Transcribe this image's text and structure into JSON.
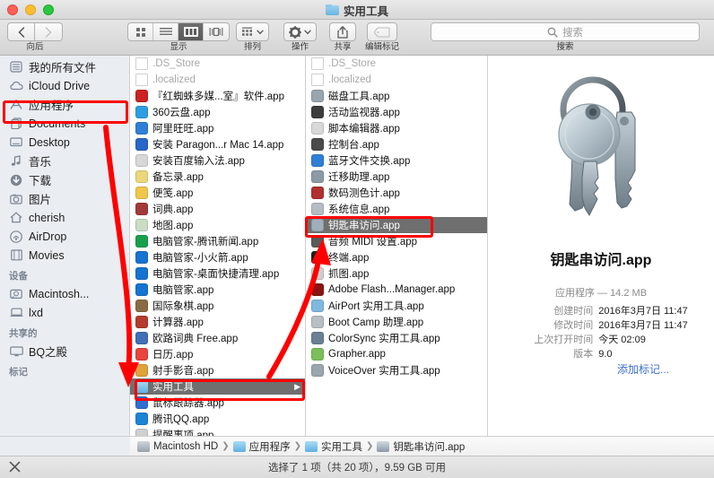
{
  "window": {
    "title": "实用工具",
    "traffic_lights": [
      "close",
      "minimize",
      "zoom"
    ]
  },
  "toolbar": {
    "back_label": "向后",
    "back_icon": "chevron-left",
    "forward_icon": "chevron-right",
    "view_label": "显示",
    "view_modes": [
      "icon-view",
      "list-view",
      "column-view",
      "coverflow-view"
    ],
    "view_active": "column-view",
    "arrange_label": "排列",
    "arrange_icon": "grid-sort",
    "action_label": "操作",
    "action_icon": "gear",
    "share_label": "共享",
    "share_icon": "share-arrow",
    "tag_label": "编辑标记",
    "tag_icon": "tag",
    "search_label": "搜索",
    "search_placeholder": "搜索"
  },
  "sidebar": {
    "favorites": [
      {
        "label": "我的所有文件",
        "icon": "all-files-icon"
      },
      {
        "label": "iCloud Drive",
        "icon": "cloud-icon"
      },
      {
        "label": "应用程序",
        "icon": "applications-icon"
      },
      {
        "label": "Documents",
        "icon": "documents-icon"
      },
      {
        "label": "Desktop",
        "icon": "desktop-icon"
      },
      {
        "label": "音乐",
        "icon": "music-icon"
      },
      {
        "label": "下载",
        "icon": "downloads-icon"
      },
      {
        "label": "图片",
        "icon": "pictures-icon"
      },
      {
        "label": "cherish",
        "icon": "home-icon"
      },
      {
        "label": "AirDrop",
        "icon": "airdrop-icon"
      },
      {
        "label": "Movies",
        "icon": "movies-icon"
      }
    ],
    "devices_header": "设备",
    "devices": [
      {
        "label": "Macintosh...",
        "icon": "harddisk-icon"
      },
      {
        "label": "lxd",
        "icon": "laptop-icon"
      }
    ],
    "shared_header": "共享的",
    "shared": [
      {
        "label": "BQ之殿",
        "icon": "display-icon"
      }
    ],
    "tags_header": "标记"
  },
  "columns": [
    {
      "name": "applications-column",
      "items": [
        {
          "label": ".DS_Store",
          "icon": "blank-doc",
          "dim": true
        },
        {
          "label": ".localized",
          "icon": "blank-doc",
          "dim": true
        },
        {
          "label": "『红蜘蛛多媒...室』软件.app",
          "icon": "red-spider",
          "color": "#cc2222"
        },
        {
          "label": "360云盘.app",
          "icon": "cloud360",
          "color": "#2e9ee0"
        },
        {
          "label": "阿里旺旺.app",
          "icon": "aliww",
          "color": "#2f7fd6"
        },
        {
          "label": "安装 Paragon...r Mac 14.app",
          "icon": "paragon",
          "color": "#2767c8"
        },
        {
          "label": "安装百度输入法.app",
          "icon": "baidu-ime",
          "color": "#d7d7d7"
        },
        {
          "label": "备忘录.app",
          "icon": "notes",
          "color": "#e9d77a"
        },
        {
          "label": "便笺.app",
          "icon": "stickies",
          "color": "#f0c64b"
        },
        {
          "label": "词典.app",
          "icon": "dictionary",
          "color": "#a33a3a"
        },
        {
          "label": "地图.app",
          "icon": "maps",
          "color": "#c9dcc4"
        },
        {
          "label": "电脑管家-腾讯新闻.app",
          "icon": "qqmgr-news",
          "color": "#19a04d"
        },
        {
          "label": "电脑管家-小火箭.app",
          "icon": "qqmgr-rocket",
          "color": "#1673d2"
        },
        {
          "label": "电脑管家-桌面快捷清理.app",
          "icon": "qqmgr-clean",
          "color": "#1673d2"
        },
        {
          "label": "电脑管家.app",
          "icon": "qqmgr",
          "color": "#1673d2"
        },
        {
          "label": "国际象棋.app",
          "icon": "chess",
          "color": "#8b6b44"
        },
        {
          "label": "计算器.app",
          "icon": "calculator",
          "color": "#b43b2e"
        },
        {
          "label": "欧路词典 Free.app",
          "icon": "eudic",
          "color": "#3f6fb5"
        },
        {
          "label": "日历.app",
          "icon": "calendar",
          "color": "#e8433c"
        },
        {
          "label": "射手影音.app",
          "icon": "splayer",
          "color": "#e0a23a"
        },
        {
          "label": "实用工具",
          "icon": "utilities-folder",
          "color": "#6fb9e6",
          "selected": true,
          "has_children": true
        },
        {
          "label": "鼠标跟踪器.app",
          "icon": "mouse-tracker",
          "color": "#2f6fd0"
        },
        {
          "label": "腾讯QQ.app",
          "icon": "qq",
          "color": "#1c84d6"
        },
        {
          "label": "提醒事项.app",
          "icon": "reminders",
          "color": "#cfcfcf",
          "clipped": true
        }
      ]
    },
    {
      "name": "utilities-column",
      "items": [
        {
          "label": ".DS_Store",
          "icon": "blank-doc",
          "dim": true
        },
        {
          "label": ".localized",
          "icon": "blank-doc",
          "dim": true
        },
        {
          "label": "磁盘工具.app",
          "icon": "disk-utility",
          "color": "#9aa6ae"
        },
        {
          "label": "活动监视器.app",
          "icon": "activity-monitor",
          "color": "#3d3d3d"
        },
        {
          "label": "脚本编辑器.app",
          "icon": "script-editor",
          "color": "#d8d8d8"
        },
        {
          "label": "控制台.app",
          "icon": "console",
          "color": "#4a4a4a"
        },
        {
          "label": "蓝牙文件交换.app",
          "icon": "bluetooth",
          "color": "#2f7fd6"
        },
        {
          "label": "迁移助理.app",
          "icon": "migration-assistant",
          "color": "#8b9aa6"
        },
        {
          "label": "数码测色计.app",
          "icon": "digital-color-meter",
          "color": "#b03030"
        },
        {
          "label": "系统信息.app",
          "icon": "system-information",
          "color": "#b6bcc2"
        },
        {
          "label": "钥匙串访问.app",
          "icon": "keychain-access",
          "color": "#9fb0bc",
          "selected": true
        },
        {
          "label": "音频 MIDI 设置.app",
          "icon": "audio-midi",
          "color": "#5a5a5a"
        },
        {
          "label": "终端.app",
          "icon": "terminal",
          "color": "#202020"
        },
        {
          "label": "抓图.app",
          "icon": "grab",
          "color": "#cfcfcf"
        },
        {
          "label": "Adobe Flash...Manager.app",
          "icon": "adobe-flash",
          "color": "#8a1414"
        },
        {
          "label": "AirPort 实用工具.app",
          "icon": "airport-utility",
          "color": "#7fb9e0"
        },
        {
          "label": "Boot Camp 助理.app",
          "icon": "boot-camp",
          "color": "#b8bec4"
        },
        {
          "label": "ColorSync 实用工具.app",
          "icon": "colorsync",
          "color": "#6b7f95"
        },
        {
          "label": "Grapher.app",
          "icon": "grapher",
          "color": "#7bbf5a"
        },
        {
          "label": "VoiceOver 实用工具.app",
          "icon": "voiceover",
          "color": "#9aa6ae"
        }
      ]
    }
  ],
  "preview": {
    "icon": "keychain-access-icon",
    "title": "钥匙串访问.app",
    "kind_size": "应用程序 — 14.2 MB",
    "fields": [
      {
        "key": "创建时间",
        "value": "2016年3月7日 11:47"
      },
      {
        "key": "修改时间",
        "value": "2016年3月7日 11:47"
      },
      {
        "key": "上次打开时间",
        "value": "今天 02:09"
      },
      {
        "key": "版本",
        "value": "9.0"
      }
    ],
    "add_tag_label": "添加标记..."
  },
  "pathbar": {
    "items": [
      {
        "label": "Macintosh HD",
        "icon": "harddisk-icon"
      },
      {
        "label": "应用程序",
        "icon": "folder-icon"
      },
      {
        "label": "实用工具",
        "icon": "folder-icon"
      },
      {
        "label": "钥匙串访问.app",
        "icon": "keychain-icon"
      }
    ],
    "separator": "❯"
  },
  "statusbar": {
    "text": "选择了 1 项（共 20 项），9.59 GB 可用",
    "close_icon": "close-x"
  },
  "annotations": {
    "accent_color": "#ff0000",
    "highlights": [
      "应用程序",
      "实用工具",
      "钥匙串访问.app"
    ],
    "arrows": 2
  }
}
